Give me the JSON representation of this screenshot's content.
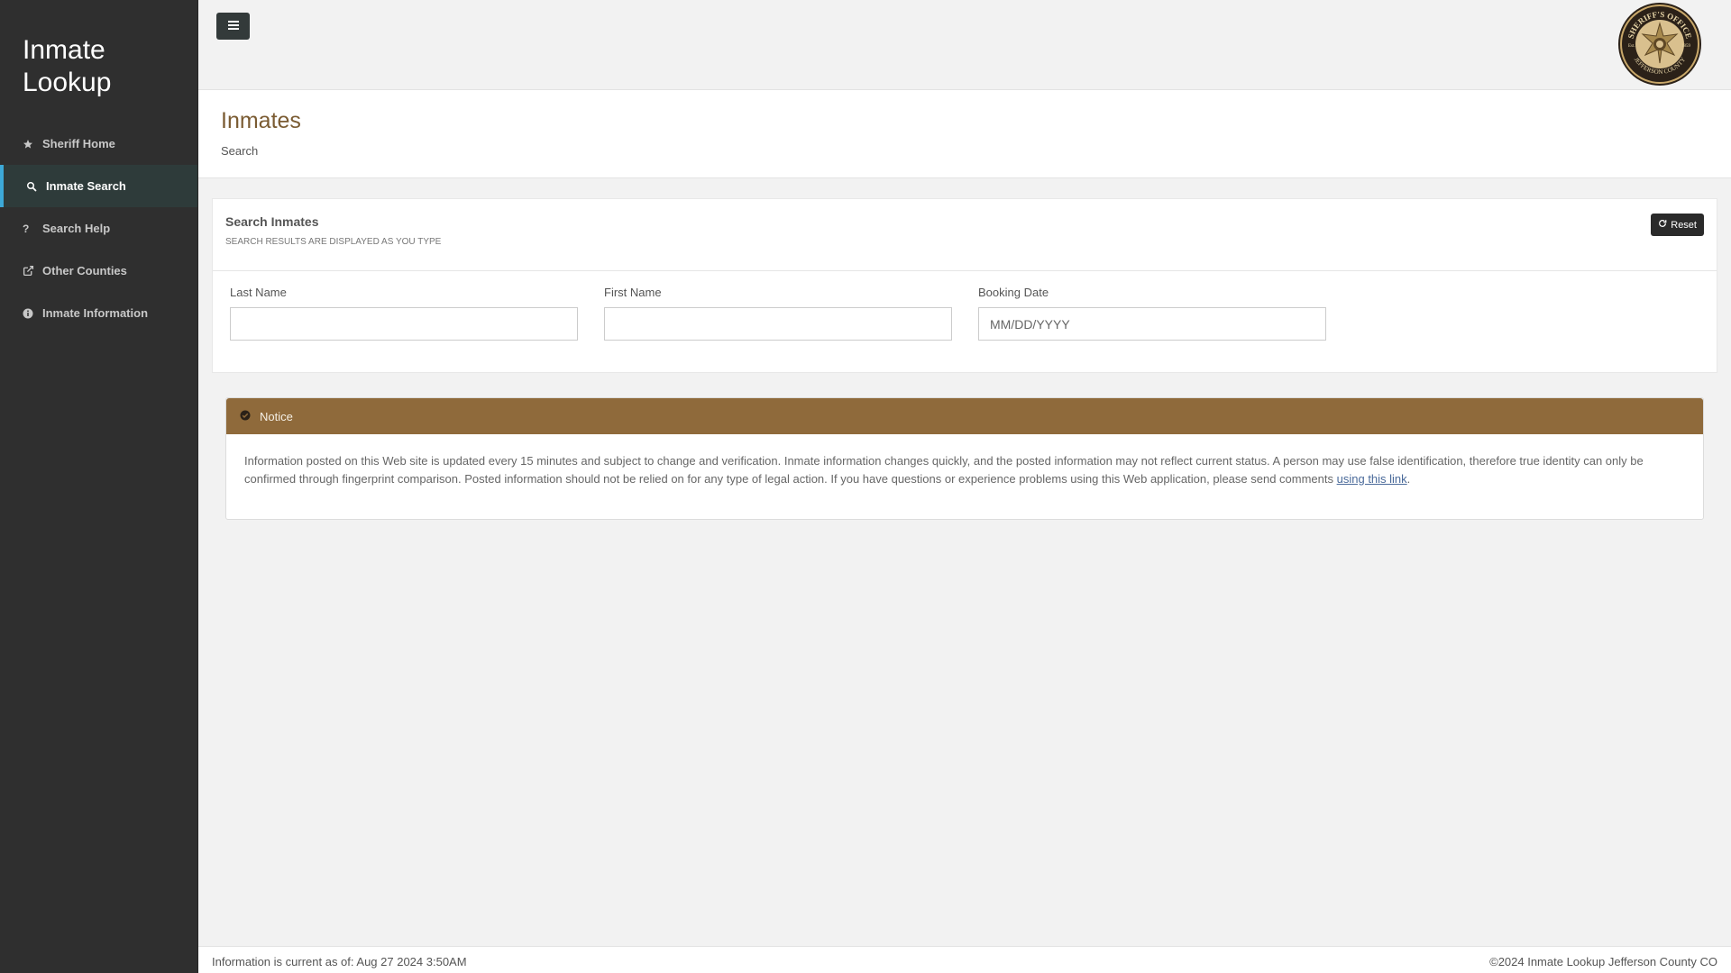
{
  "app": {
    "brand_line1": "Inmate",
    "brand_line2": "Lookup"
  },
  "sidebar": {
    "items": [
      {
        "label": "Sheriff Home",
        "icon": "star-icon"
      },
      {
        "label": "Inmate Search",
        "icon": "search-icon",
        "active": true
      },
      {
        "label": "Search Help",
        "icon": "question-icon"
      },
      {
        "label": "Other Counties",
        "icon": "external-link-icon"
      },
      {
        "label": "Inmate Information",
        "icon": "info-icon"
      }
    ]
  },
  "header": {
    "title": "Inmates",
    "subtitle": "Search"
  },
  "search_panel": {
    "title": "Search Inmates",
    "subtitle": "SEARCH RESULTS ARE DISPLAYED AS YOU TYPE",
    "reset_label": "Reset",
    "fields": [
      {
        "label": "Last Name",
        "value": "",
        "placeholder": ""
      },
      {
        "label": "First Name",
        "value": "",
        "placeholder": ""
      },
      {
        "label": "Booking Date",
        "value": "",
        "placeholder": "MM/DD/YYYY"
      }
    ]
  },
  "notice": {
    "title": "Notice",
    "body": "Information posted on this Web site is updated every 15 minutes and subject to change and verification. Inmate information changes quickly, and the posted information may not reflect current status. A person may use false identification, therefore true identity can only be confirmed through fingerprint comparison. Posted information should not be relied on for any type of legal action. If you have questions or experience problems using this Web application, please send comments ",
    "link_text": "using this link",
    "trailing": "."
  },
  "seal": {
    "top_text": "SHERIFF'S OFFICE",
    "bottom_text": "JEFFERSON COUNTY",
    "est_label": "Est.",
    "est_year": "1859"
  },
  "footer": {
    "left": "Information is current as of: Aug 27 2024 3:50AM",
    "right": "©2024 Inmate Lookup Jefferson County CO"
  },
  "colors": {
    "accent": "#3da9d8",
    "brand": "#8f6a3b",
    "title": "#7a5b32",
    "sidebar": "#2f2f2f"
  }
}
